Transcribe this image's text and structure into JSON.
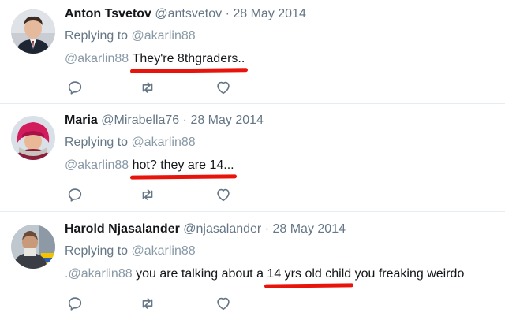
{
  "tweets": [
    {
      "name": "Anton Tsvetov",
      "handle": "@antsvetov",
      "sep": "·",
      "date": "28 May 2014",
      "replying_label": "Replying to",
      "replying_to": "@akarlin88",
      "text_prefix": "",
      "mention": "@akarlin88",
      "text_pre": "",
      "text_highlight": "They're 8thgraders..",
      "text_post": ""
    },
    {
      "name": "Maria",
      "handle": "@Mirabella76",
      "sep": "·",
      "date": "28 May 2014",
      "replying_label": "Replying to",
      "replying_to": "@akarlin88",
      "text_prefix": "",
      "mention": "@akarlin88",
      "text_pre": "",
      "text_highlight": "hot? they are 14...",
      "text_post": ""
    },
    {
      "name": "Harold Njasalander",
      "handle": "@njasalander",
      "sep": "·",
      "date": "28 May 2014",
      "replying_label": "Replying to",
      "replying_to": "@akarlin88",
      "text_prefix": ".",
      "mention": "@akarlin88",
      "text_pre": "you are talking about a",
      "text_highlight": "14 yrs old child",
      "text_post": "you freaking weirdo"
    }
  ],
  "icons": {
    "reply": "reply-icon",
    "retweet": "retweet-icon",
    "like": "heart-icon"
  },
  "colors": {
    "text": "#14171a",
    "muted": "#657786",
    "mention": "#8899a6",
    "highlight_underline": "#e8140c",
    "divider": "#e6ecf0"
  }
}
